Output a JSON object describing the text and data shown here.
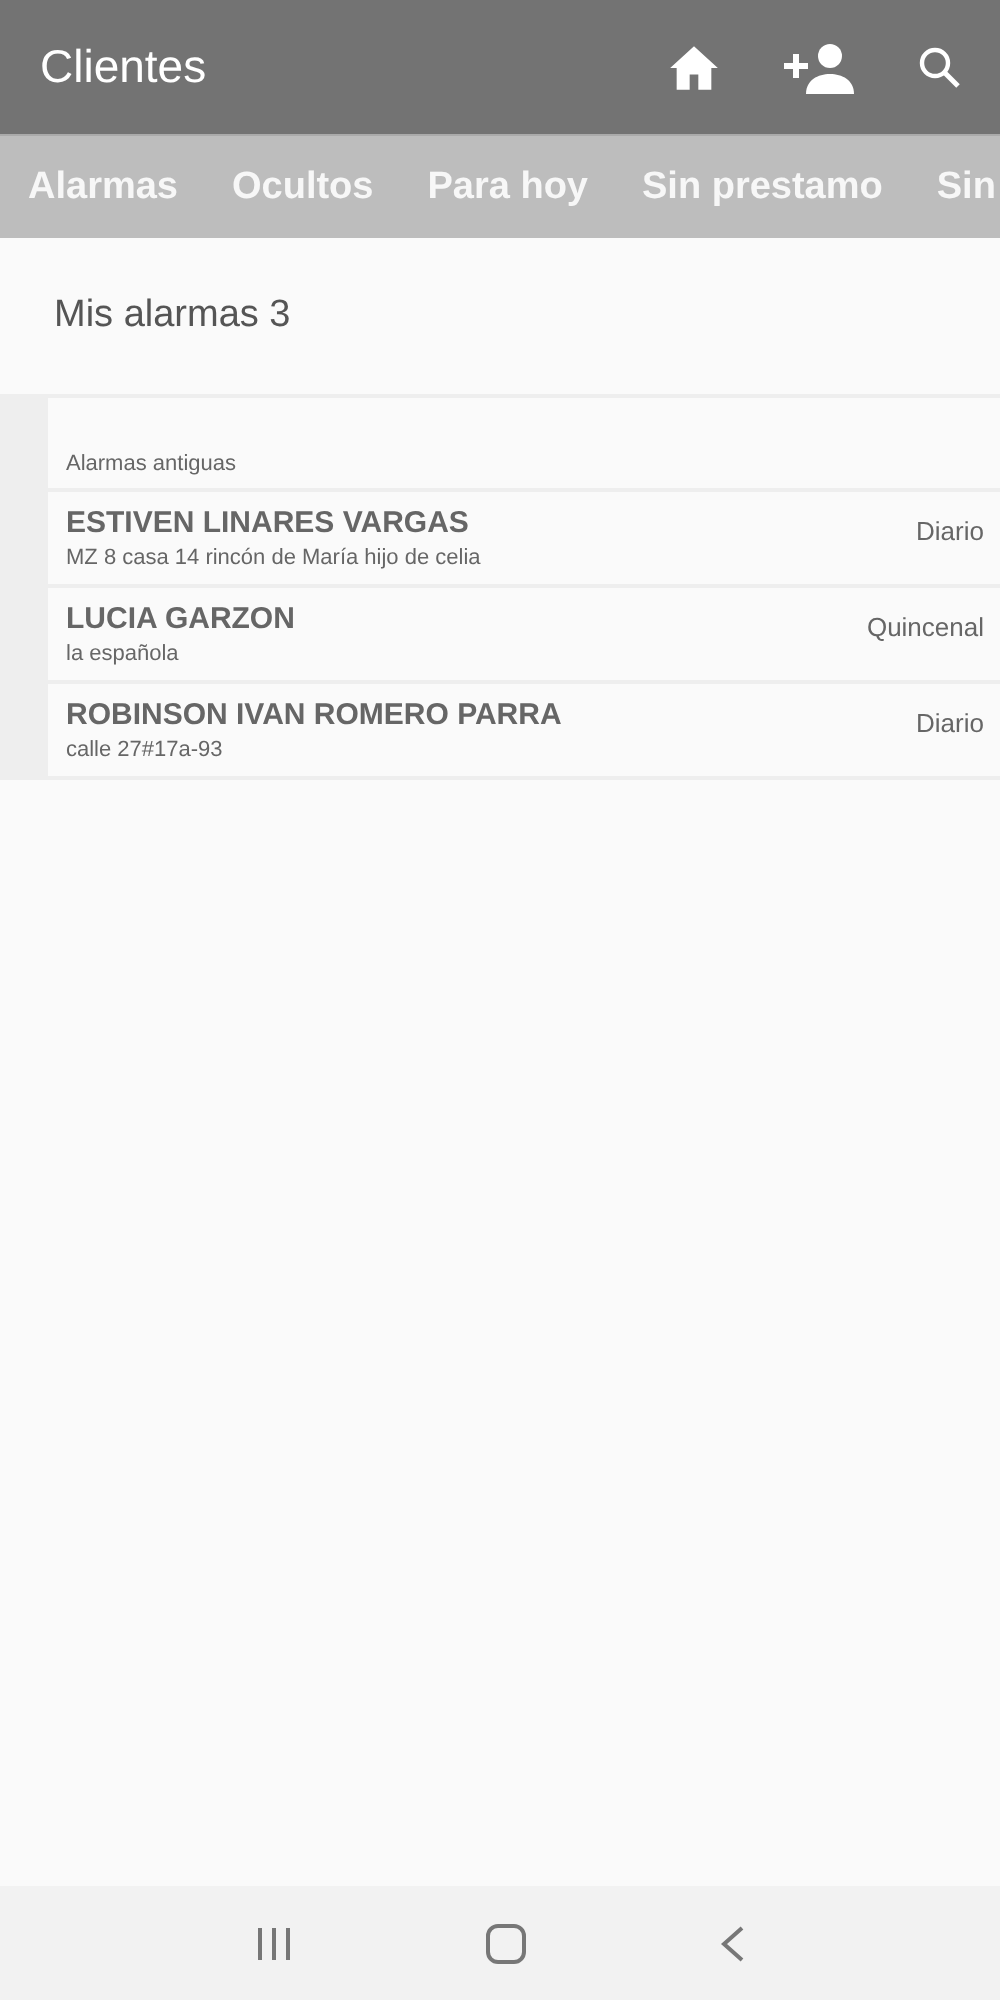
{
  "app_bar": {
    "title": "Clientes"
  },
  "tabs": [
    {
      "label": "Alarmas"
    },
    {
      "label": "Ocultos"
    },
    {
      "label": "Para hoy"
    },
    {
      "label": "Sin prestamo"
    },
    {
      "label": "Sin"
    }
  ],
  "summary": "Mis alarmas 3",
  "section": "Alarmas antiguas",
  "clients": [
    {
      "name": "ESTIVEN LINARES VARGAS",
      "address": "MZ 8 casa 14 rincón de María hijo de celia",
      "frequency": "Diario"
    },
    {
      "name": "LUCIA GARZON",
      "address": "la española",
      "frequency": "Quincenal"
    },
    {
      "name": "ROBINSON IVAN ROMERO PARRA",
      "address": "calle 27#17a-93",
      "frequency": "Diario"
    }
  ]
}
